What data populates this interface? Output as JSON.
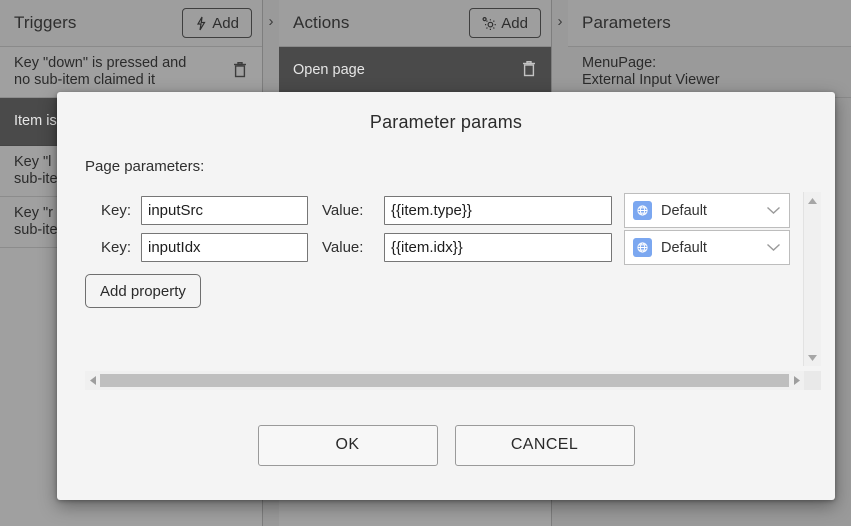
{
  "background": {
    "columns": [
      {
        "title": "Triggers",
        "add_label": "Add",
        "add_icon": "lightning-bolt-icon",
        "chevron_icon": "chevron-right-icon",
        "items": [
          {
            "text": "Key \"down\" is pressed and\nno sub-item claimed it",
            "selected": false,
            "delete_icon": "trash-icon"
          },
          {
            "text": "Item is",
            "selected": true,
            "delete_icon": "trash-icon"
          },
          {
            "text": "Key \"l\nsub-ite",
            "selected": false,
            "delete_icon": "trash-icon"
          },
          {
            "text": "Key \"r\nsub-ite",
            "selected": false,
            "delete_icon": "trash-icon"
          }
        ]
      },
      {
        "title": "Actions",
        "add_label": "Add",
        "add_icon": "gear-icon",
        "chevron_icon": "chevron-right-icon",
        "items": [
          {
            "text": "Open page",
            "selected": true,
            "delete_icon": "trash-icon"
          }
        ]
      },
      {
        "title": "Parameters",
        "add_label": "",
        "add_icon": "",
        "chevron_icon": "chevron-right-icon",
        "items": [
          {
            "text": "MenuPage:\nExternal Input Viewer",
            "selected": false,
            "delete_icon": ""
          }
        ]
      }
    ]
  },
  "dialog": {
    "title": "Parameter params",
    "section_label": "Page parameters:",
    "key_label": "Key:",
    "value_label": "Value:",
    "rows": [
      {
        "key": "inputSrc",
        "value": "{{item.type}}",
        "select_text": "Default",
        "select_icon": "globe-icon",
        "chevron_icon": "chevron-down-icon"
      },
      {
        "key": "inputIdx",
        "value": "{{item.idx}}",
        "select_text": "Default",
        "select_icon": "globe-icon",
        "chevron_icon": "chevron-down-icon"
      }
    ],
    "add_property_label": "Add property",
    "ok_label": "OK",
    "cancel_label": "CANCEL",
    "scroll": {
      "up_icon": "scroll-up-arrow-icon",
      "down_icon": "scroll-down-arrow-icon",
      "left_icon": "scroll-left-arrow-icon",
      "right_icon": "scroll-right-arrow-icon"
    }
  },
  "colors": {
    "select_icon_bg": "#7ba7f0",
    "selected_row_bg": "#4a4a4a",
    "panel_bg": "#9a9a9a",
    "dialog_bg": "#f4f4f4"
  }
}
